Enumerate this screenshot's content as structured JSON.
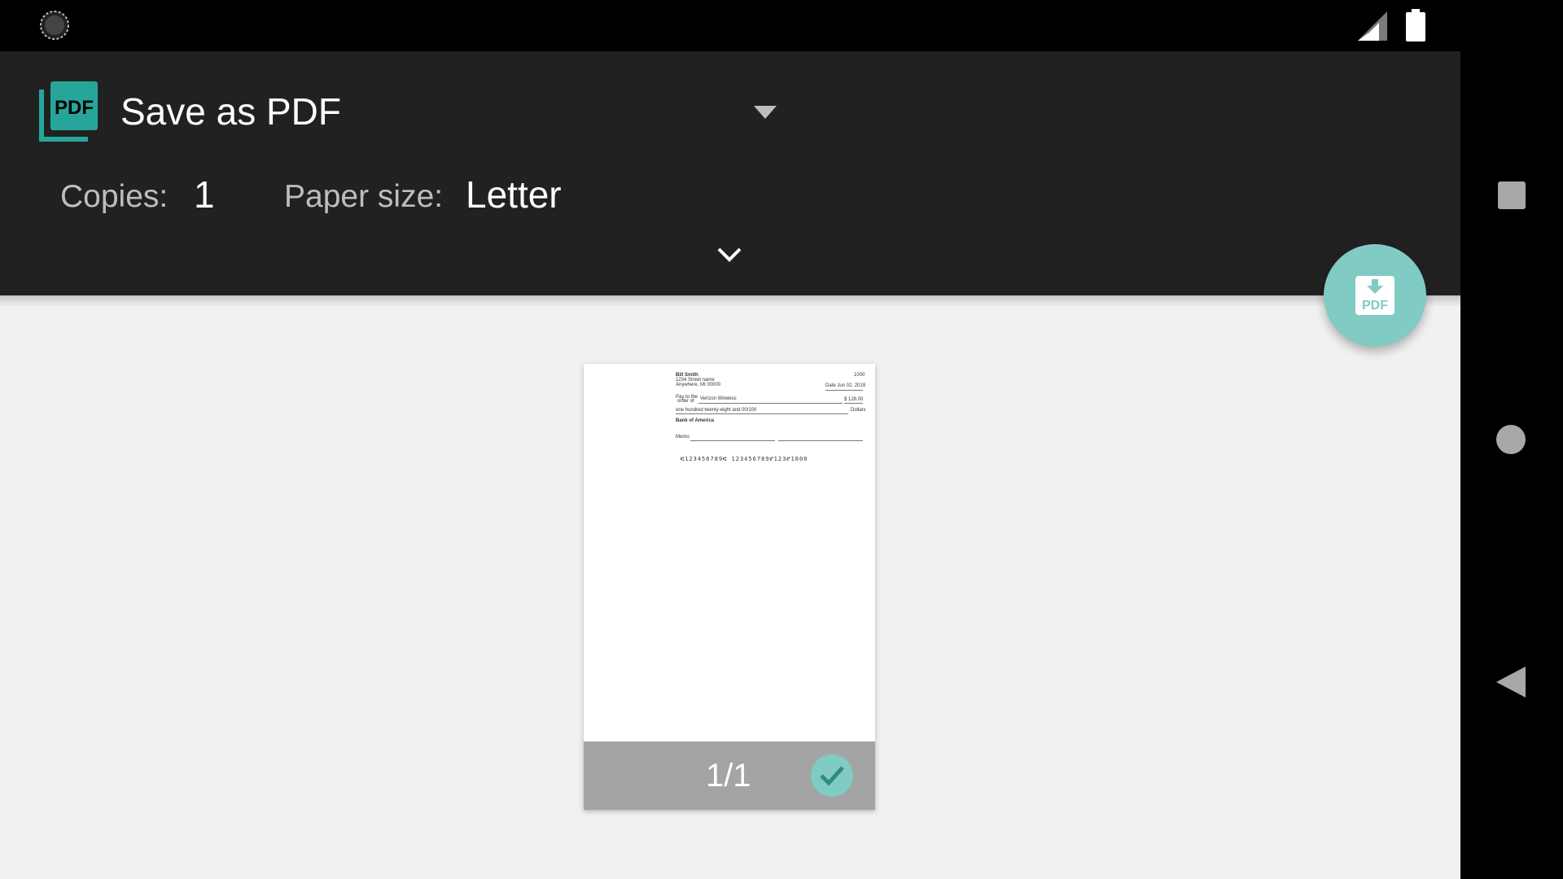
{
  "status_bar": {
    "icons": [
      "loading-spinner-icon",
      "cell-signal-icon",
      "battery-icon"
    ]
  },
  "printer": {
    "name": "Save as PDF",
    "icon": "pdf-icon"
  },
  "options": {
    "copies_label": "Copies:",
    "copies_value": "1",
    "paper_size_label": "Paper size:",
    "paper_size_value": "Letter"
  },
  "fab": {
    "label": "PDF",
    "icon": "download-pdf-icon"
  },
  "preview": {
    "page_counter": "1/1",
    "selected": true,
    "check_document": {
      "payer_name": "Bill Smith",
      "payer_address_line1": "1234 Street name",
      "payer_address_line2": "Anywhere, MI 00000",
      "check_number": "1000",
      "date_text": "Date Jun 02, 2019",
      "pay_to_label_1": "Pay to the",
      "pay_to_label_2": "order of",
      "payee": "Verizon Wireless",
      "amount": "$ 128.00",
      "amount_words": "one hundred twenty-eight and 00/100",
      "dollars_label": "Dollars",
      "bank": "Bank of America",
      "memo_label": "Memo",
      "micr_line": "⑆123456789⑆ 123456789⑈123⑈1000"
    }
  },
  "navigation": {
    "icons": [
      "recents-square-icon",
      "home-circle-icon",
      "back-triangle-icon"
    ]
  },
  "colors": {
    "header_bg": "#212121",
    "accent": "#80cbc4",
    "pdf_green": "#26a69a",
    "content_bg": "#f1f1f1",
    "page_footer_bg": "#a4a4a4"
  }
}
